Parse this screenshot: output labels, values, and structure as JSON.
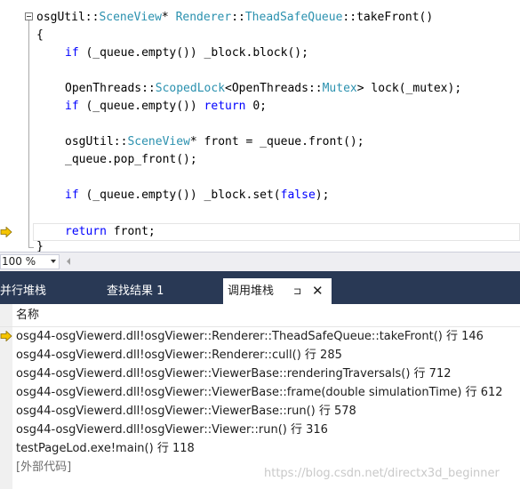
{
  "editor": {
    "lines": {
      "l1": {
        "ns": "osgUtil",
        "sep1": "::",
        "cls": "SceneView",
        "star": "* ",
        "cls2": "Renderer",
        "sep2": "::",
        "cls3": "TheadSafeQueue",
        "sep3": "::",
        "fn": "takeFront()"
      },
      "l2": "{",
      "l3": {
        "kw": "if",
        "rest": " (_queue.empty()) _block.block();"
      },
      "l4": {
        "a": "OpenThreads::",
        "t1": "ScopedLock",
        "b": "<OpenThreads::",
        "t2": "Mutex",
        "c": "> lock(_mutex);"
      },
      "l5": {
        "kw": "if",
        "mid": " (_queue.empty()) ",
        "kw2": "return",
        "rest": " 0;"
      },
      "l6": {
        "a": "osgUtil::",
        "t1": "SceneView",
        "b": "* front = _queue.front();"
      },
      "l7": "_queue.pop_front();",
      "l8": {
        "kw": "if",
        "mid": " (_queue.empty()) _block.set(",
        "kw2": "false",
        "rest": ");"
      },
      "l9": {
        "kw": "return",
        "rest": " front;"
      },
      "l10": "}"
    }
  },
  "zoom": {
    "value": "100 %"
  },
  "tabs": {
    "parallel": "并行堆栈",
    "find": "查找结果 1",
    "callstack": "调用堆栈",
    "pin_glyph": "⊐",
    "close_glyph": "✕"
  },
  "callstack": {
    "header": "名称",
    "frames": [
      "osg44-osgViewerd.dll!osgViewer::Renderer::TheadSafeQueue::takeFront() 行 146",
      "osg44-osgViewerd.dll!osgViewer::Renderer::cull() 行 285",
      "osg44-osgViewerd.dll!osgViewer::ViewerBase::renderingTraversals() 行 712",
      "osg44-osgViewerd.dll!osgViewer::ViewerBase::frame(double simulationTime) 行 612",
      "osg44-osgViewerd.dll!osgViewer::ViewerBase::run() 行 578",
      "osg44-osgViewerd.dll!osgViewer::Viewer::run() 行 316",
      "testPageLod.exe!main() 行 118",
      "[外部代码]"
    ]
  },
  "watermark": "https://blog.csdn.net/directx3d_beginner",
  "colors": {
    "keyword": "#0000ff",
    "type": "#2b91af",
    "tabstrip": "#293955",
    "arrow": "#f5c400"
  }
}
